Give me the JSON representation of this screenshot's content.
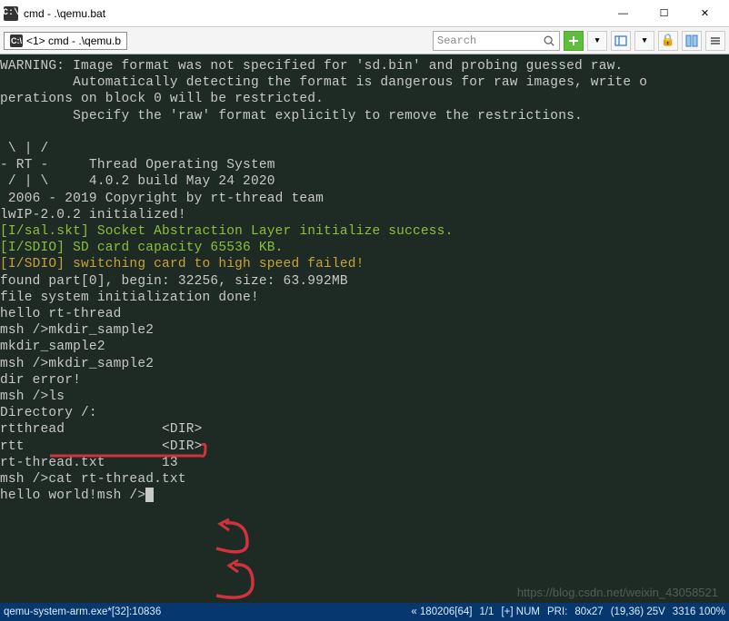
{
  "window": {
    "title": "cmd - .\\qemu.bat",
    "icon_label": "C:\\"
  },
  "tab": {
    "label": "<1> cmd - .\\qemu.b",
    "icon_label": "C:\\"
  },
  "search": {
    "placeholder": "Search"
  },
  "terminal": {
    "l1": "WARNING: Image format was not specified for 'sd.bin' and probing guessed raw.",
    "l2": "         Automatically detecting the format is dangerous for raw images, write o",
    "l3": "perations on block 0 will be restricted.",
    "l4": "         Specify the 'raw' format explicitly to remove the restrictions.",
    "l5": "",
    "l6": " \\ | /",
    "l7": "- RT -     Thread Operating System",
    "l8": " / | \\     4.0.2 build May 24 2020",
    "l9": " 2006 - 2019 Copyright by rt-thread team",
    "l10": "lwIP-2.0.2 initialized!",
    "l11": "[I/sal.skt] Socket Abstraction Layer initialize success.",
    "l12": "[I/SDIO] SD card capacity 65536 KB.",
    "l13": "[I/SDIO] switching card to high speed failed!",
    "l14": "found part[0], begin: 32256, size: 63.992MB",
    "l15": "file system initialization done!",
    "l16": "hello rt-thread",
    "l17": "msh />mkdir_sample2",
    "l18": "mkdir_sample2",
    "l19": "msh />mkdir_sample2",
    "l20": "dir error!",
    "l21": "msh />ls",
    "l22": "Directory /:",
    "l23": "rtthread            <DIR>",
    "l24": "rtt                 <DIR>",
    "l25": "rt-thread.txt       13",
    "l26": "msh />cat rt-thread.txt",
    "l27": "hello world!msh />"
  },
  "watermark": "https://blog.csdn.net/weixin_43058521",
  "status": {
    "proc": "qemu-system-arm.exe*[32]:10836",
    "enc": "« 180206[64]",
    "pos": "1/1",
    "num": "[+] NUM",
    "pri": "PRI:",
    "size": "80x27",
    "coord": "(19,36) 25V",
    "extra": "3316 100%"
  },
  "icon_glyphs": {
    "minimize": "—",
    "maximize": "☐",
    "close": "✕",
    "dropdown": "▾",
    "lock": "🔒",
    "panel": "▯▯"
  }
}
